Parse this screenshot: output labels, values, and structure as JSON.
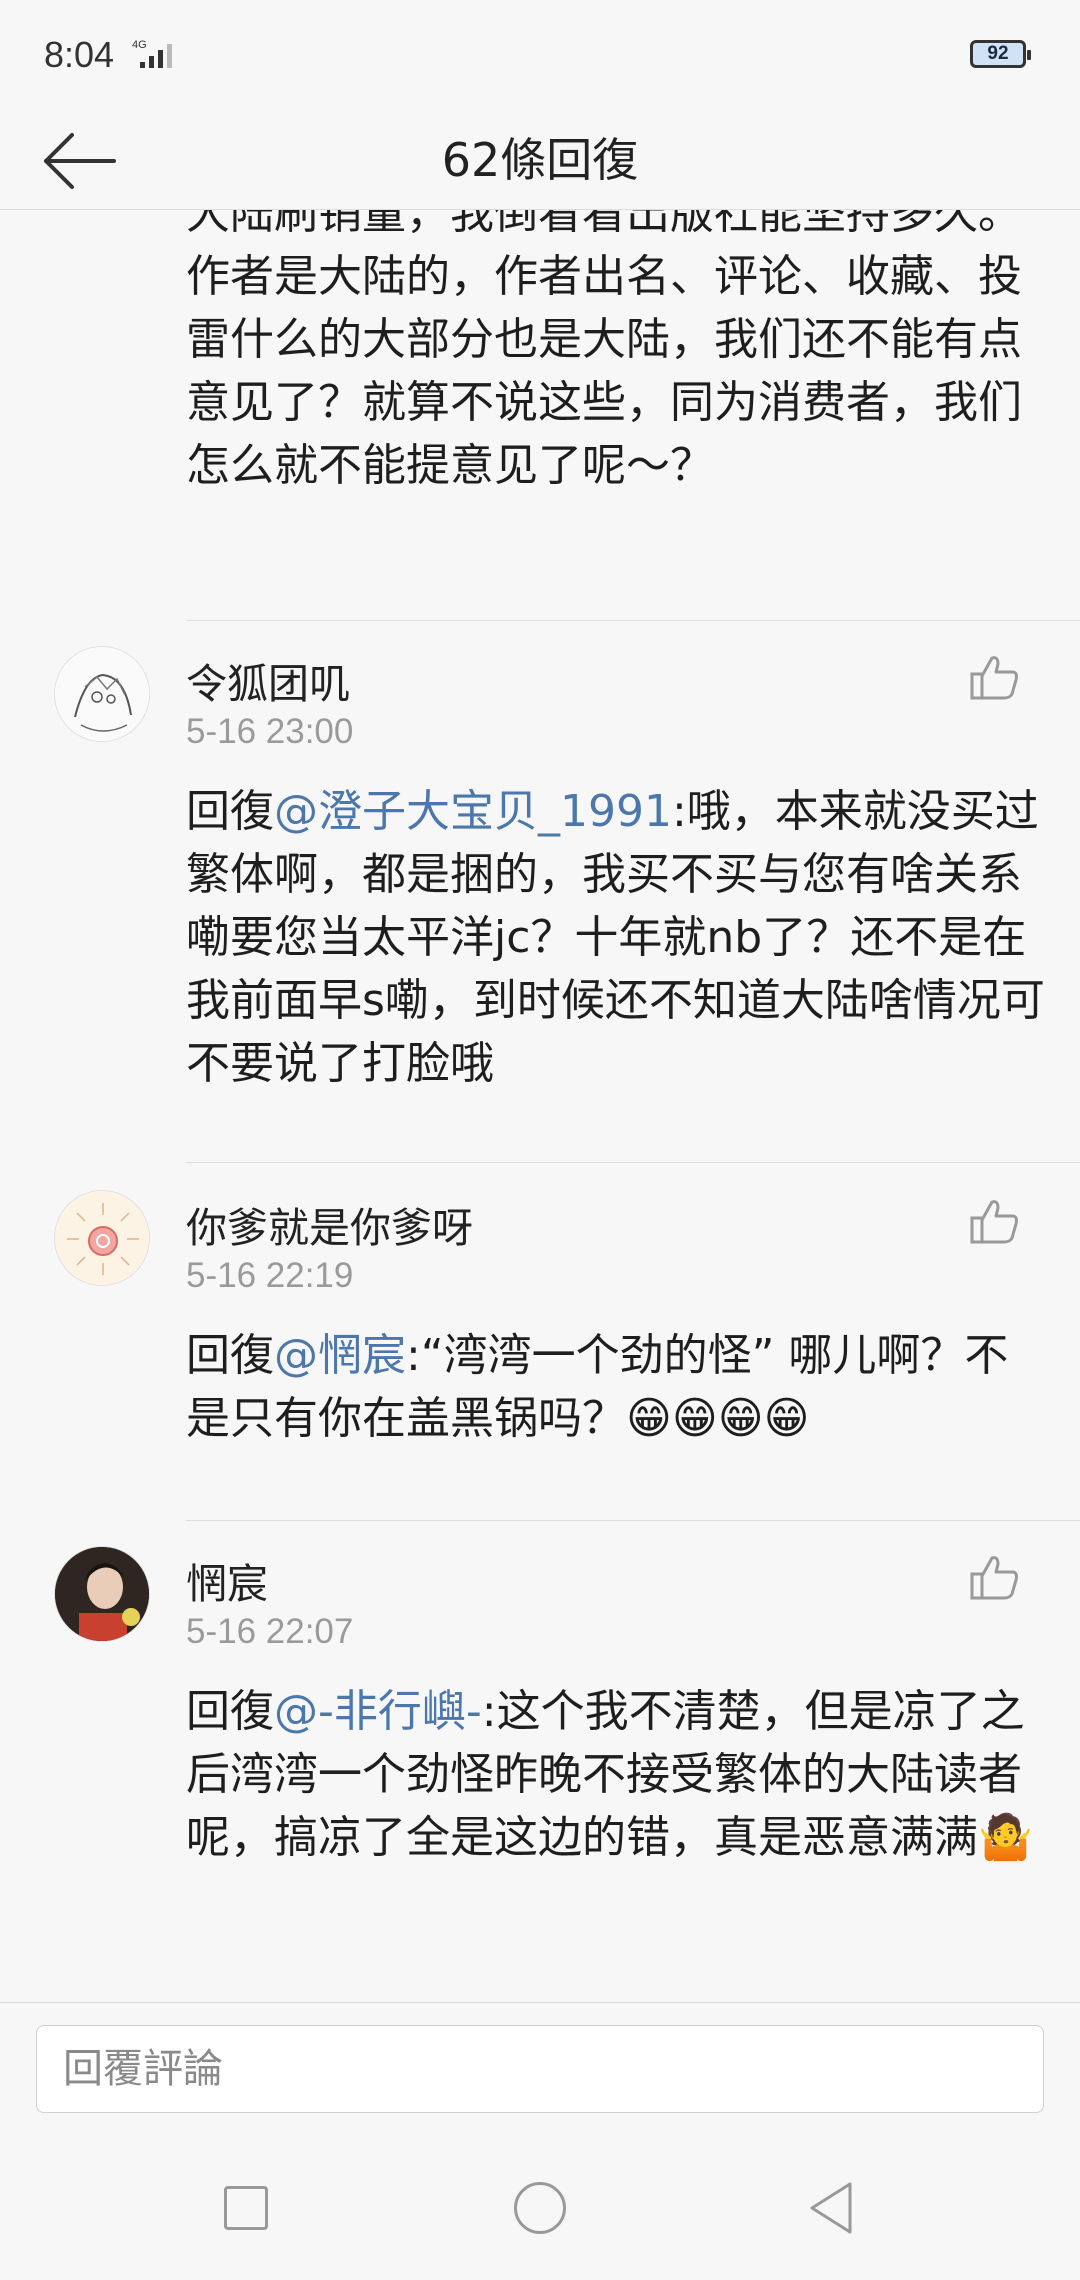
{
  "status_bar": {
    "time": "8:04",
    "battery": "92",
    "network": "4G"
  },
  "header": {
    "title": "62條回復"
  },
  "truncated_comment": {
    "text": "大陆刷销量，我倒看看出版社能坚持多久。作者是大陆的，作者出名、评论、收藏、投雷什么的大部分也是大陆，我们还不能有点意见了？就算不说这些，同为消费者，我们怎么就不能提意见了呢～？"
  },
  "comments": [
    {
      "username": "令狐团叽",
      "time": "5-16 23:00",
      "reply_prefix": "回復",
      "mention": "@澄子大宝贝_1991",
      "text": ":哦，本来就没买过繁体啊，都是捆的，我买不买与您有啥关系嘞要您当太平洋jc？十年就nb了？还不是在我前面早s嘞，到时候还不知道大陆啥情况可不要说了打脸哦",
      "avatar_icon": "sketch-avatar-icon"
    },
    {
      "username": "你爹就是你爹呀",
      "time": "5-16 22:19",
      "reply_prefix": "回復",
      "mention": "@惘宸",
      "text": ":“湾湾一个劲的怪” 哪儿啊？不是只有你在盖黑锅吗？😁😁😁😁",
      "avatar_icon": "sun-avatar-icon"
    },
    {
      "username": "惘宸",
      "time": "5-16 22:07",
      "reply_prefix": "回復",
      "mention": "@-非行嶼-",
      "text": ":这个我不清楚，但是凉了之后湾湾一个劲怪昨晚不接受繁体的大陆读者呢，搞凉了全是这边的错，真是恶意满满🤷",
      "avatar_icon": "photo-avatar-icon"
    }
  ],
  "reply_bar": {
    "placeholder": "回覆評論"
  },
  "colors": {
    "mention": "#4b77ad",
    "background": "#f7f7f7",
    "timestamp": "#9a9a9a"
  }
}
